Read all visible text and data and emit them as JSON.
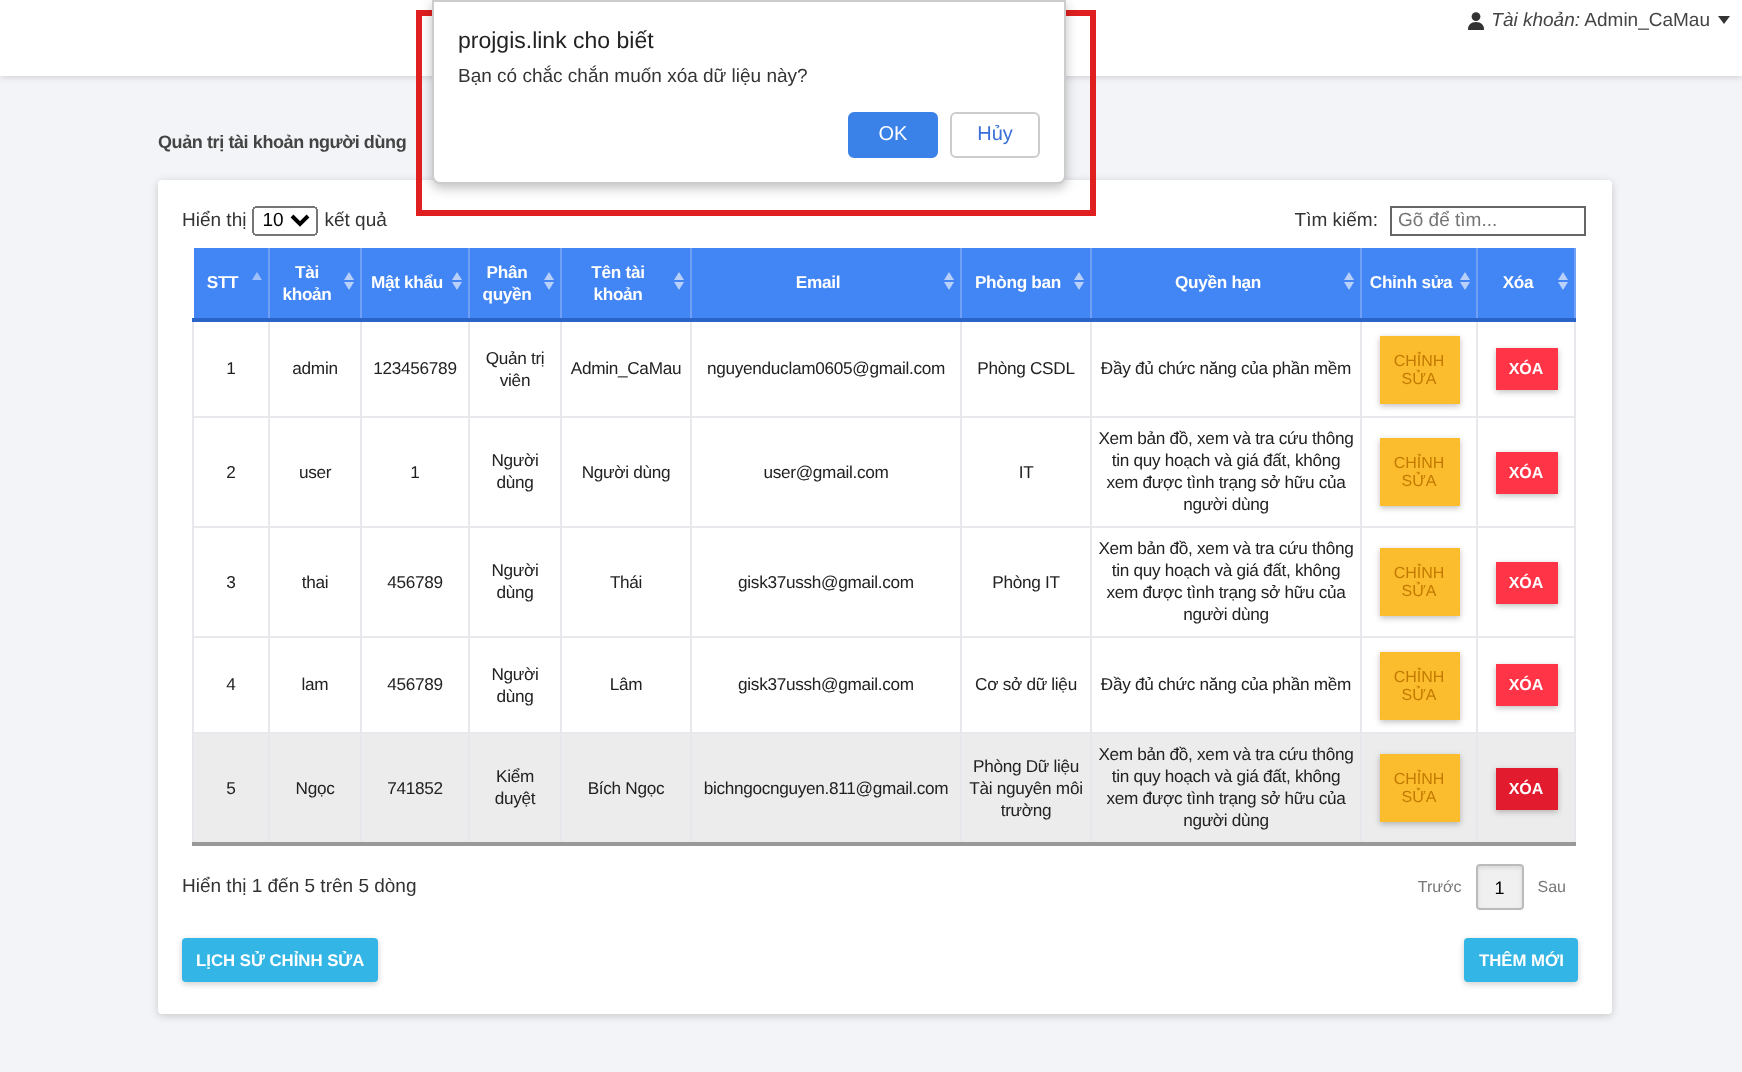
{
  "account": {
    "label": "Tài khoản:",
    "name": "Admin_CaMau"
  },
  "page_title": "Quản trị tài khoản người dùng",
  "length_control": {
    "prefix": "Hiển thị",
    "value": "10",
    "suffix": "kết quả"
  },
  "search": {
    "label": "Tìm kiếm:",
    "placeholder": "Gõ để tìm..."
  },
  "table": {
    "columns": [
      {
        "label": "STT",
        "sorted": true
      },
      {
        "label": "Tài khoản",
        "sorted": false
      },
      {
        "label": "Mật khẩu",
        "sorted": false
      },
      {
        "label": "Phân quyền",
        "sorted": false
      },
      {
        "label": "Tên tài khoản",
        "sorted": false
      },
      {
        "label": "Email",
        "sorted": false
      },
      {
        "label": "Phòng ban",
        "sorted": false
      },
      {
        "label": "Quyền hạn",
        "sorted": false
      },
      {
        "label": "Chỉnh sửa",
        "sorted": false
      },
      {
        "label": "Xóa",
        "sorted": false
      }
    ],
    "rows": [
      {
        "cells": [
          "1",
          "admin",
          "123456789",
          "Quản trị viên",
          "Admin_CaMau",
          "nguyenduclam0605@gmail.com",
          "Phòng CSDL",
          "Đầy đủ chức năng của phần mềm"
        ],
        "edit_button": "CHỈNH SỬA",
        "delete_button": "XÓA",
        "highlighted": false
      },
      {
        "cells": [
          "2",
          "user",
          "1",
          "Người dùng",
          "Người dùng",
          "user@gmail.com",
          "IT",
          "Xem bản đồ, xem và tra cứu thông tin quy hoạch và giá đất, không xem được tình trạng sở hữu của người dùng"
        ],
        "edit_button": "CHỈNH SỬA",
        "delete_button": "XÓA",
        "highlighted": false
      },
      {
        "cells": [
          "3",
          "thai",
          "456789",
          "Người dùng",
          "Thái",
          "gisk37ussh@gmail.com",
          "Phòng IT",
          "Xem bản đồ, xem và tra cứu thông tin quy hoạch và giá đất, không xem được tình trạng sở hữu của người dùng"
        ],
        "edit_button": "CHỈNH SỬA",
        "delete_button": "XÓA",
        "highlighted": false
      },
      {
        "cells": [
          "4",
          "lam",
          "456789",
          "Người dùng",
          "Lâm",
          "gisk37ussh@gmail.com",
          "Cơ sở dữ liệu",
          "Đầy đủ chức năng của phần mềm"
        ],
        "edit_button": "CHỈNH SỬA",
        "delete_button": "XÓA",
        "highlighted": false
      },
      {
        "cells": [
          "5",
          "Ngọc",
          "741852",
          "Kiểm duyệt",
          "Bích Ngọc",
          "bichngocnguyen.811@gmail.com",
          "Phòng Dữ liệu Tài nguyên môi trường",
          "Xem bản đồ, xem và tra cứu thông tin quy hoạch và giá đất, không xem được tình trạng sở hữu của người dùng"
        ],
        "edit_button": "CHỈNH SỬA",
        "delete_button": "XÓA",
        "highlighted": true
      }
    ]
  },
  "info": "Hiển thị 1 đến 5 trên 5 dòng",
  "pagination": {
    "previous": "Trước",
    "pages": [
      {
        "label": "1",
        "selected": true
      }
    ],
    "next": "Sau"
  },
  "buttons": {
    "history": "LỊCH SỬ CHỈNH SỬA",
    "add": "THÊM MỚI"
  },
  "dialog": {
    "title": "projgis.link cho biết",
    "message": "Bạn có chắc chắn muốn xóa dữ liệu này?",
    "annotated": true,
    "buttons": [
      {
        "label": "OK",
        "kind": "primary"
      },
      {
        "label": "Hủy",
        "kind": "secondary"
      }
    ]
  }
}
